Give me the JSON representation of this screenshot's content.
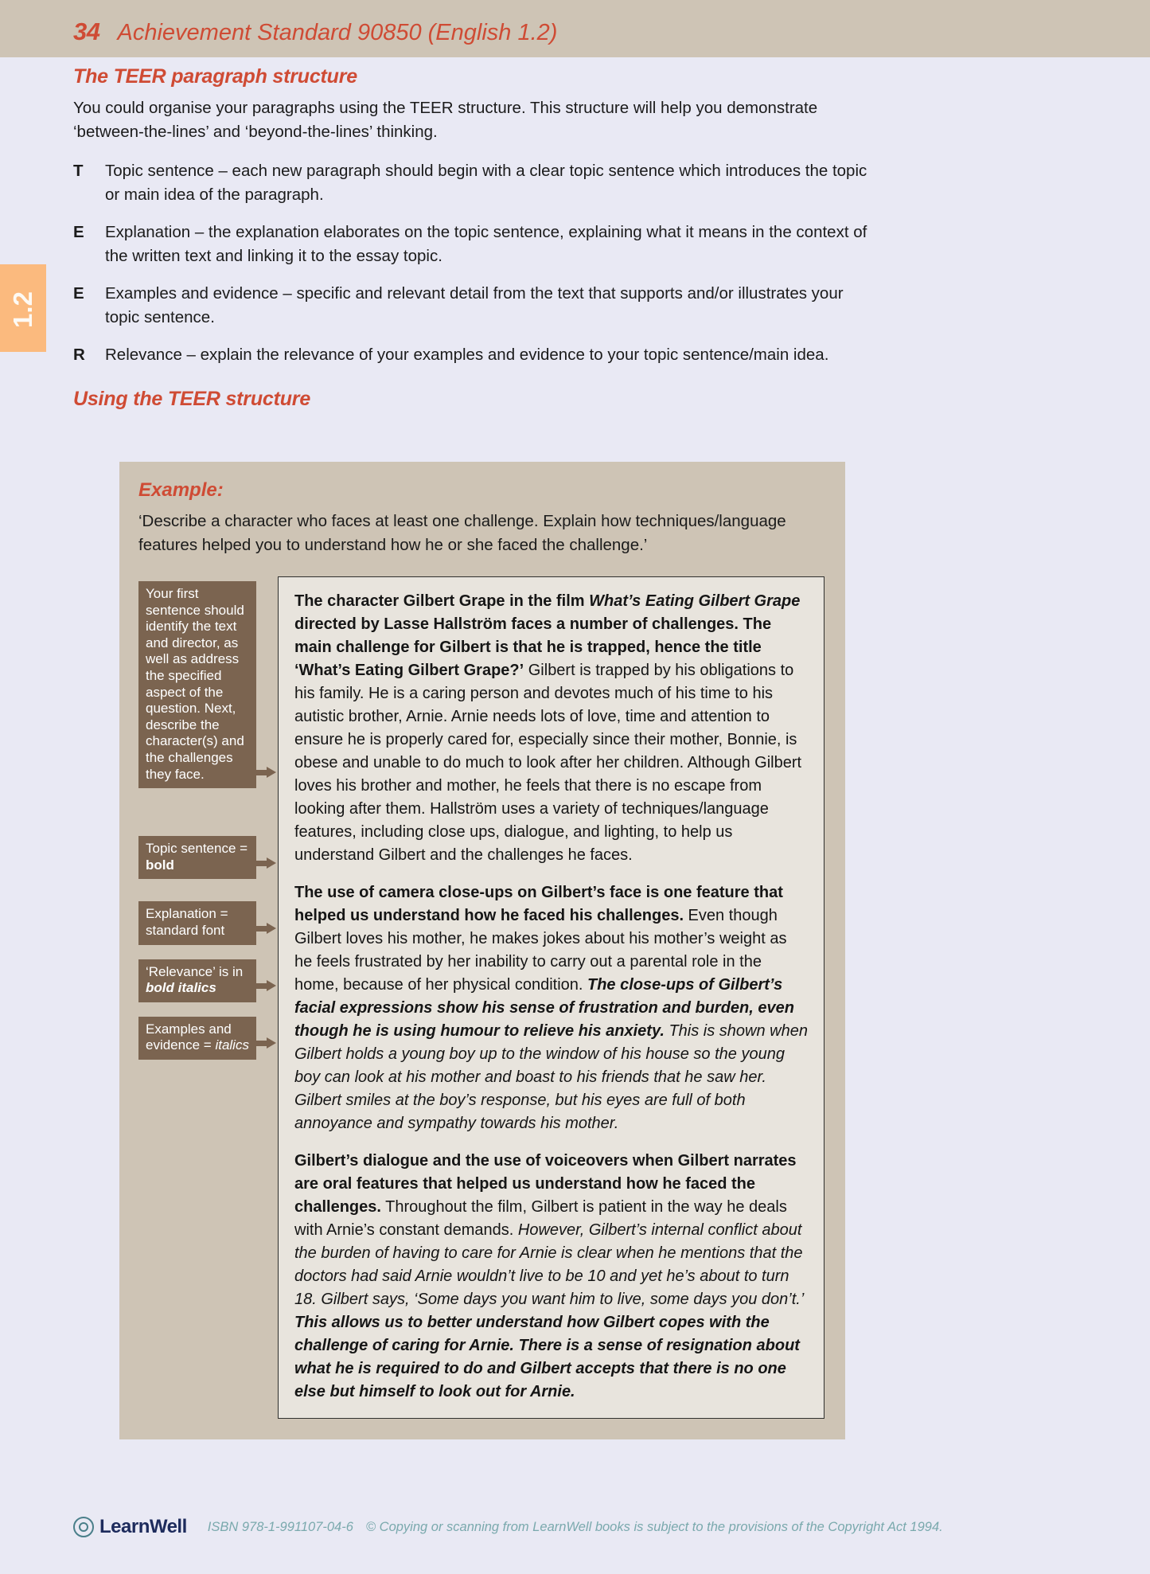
{
  "header": {
    "page_number": "34",
    "title": "Achievement Standard 90850 (English 1.2)"
  },
  "side_tab": {
    "label": "1.2"
  },
  "sections": {
    "heading_1": "The TEER paragraph structure",
    "intro": "You could organise your paragraphs using the TEER structure. This structure will help you demonstrate ‘between-the-lines’ and ‘beyond-the-lines’ thinking.",
    "heading_2": "Using the TEER structure"
  },
  "teer_items": [
    {
      "letter": "T",
      "text": "Topic sentence – each new paragraph should begin with a clear topic sentence which introduces the topic or main idea of the paragraph."
    },
    {
      "letter": "E",
      "text": "Explanation – the explanation elaborates on the topic sentence, explaining what it means in the context of the written text and linking it to the essay topic."
    },
    {
      "letter": "E",
      "text": "Examples and evidence – specific and relevant detail from the text that supports and/or illustrates your topic sentence."
    },
    {
      "letter": "R",
      "text": "Relevance – explain the relevance of your examples and evidence to your topic sentence/main idea."
    }
  ],
  "example_box": {
    "title": "Example:",
    "prompt": "‘Describe a character who faces at least one challenge. Explain how techniques/language features helped you to understand how he or she faced the challenge.’",
    "callouts": [
      {
        "id": "first-sentence",
        "text_plain": "Your first sentence should identify the text and director, as well as address the specified aspect of the question. Next, describe the character(s) and the challenges they face."
      },
      {
        "id": "topic-sentence",
        "line1": "Topic sentence =",
        "line2_bold": "bold"
      },
      {
        "id": "explanation",
        "line1": "Explanation =",
        "line2": "standard font"
      },
      {
        "id": "relevance",
        "line1": "‘Relevance’ is in",
        "line2_bold_italic": "bold italics"
      },
      {
        "id": "examples-evidence",
        "line1": "Examples and",
        "line2_prefix": "evidence = ",
        "line2_italic": "italics"
      }
    ],
    "essay_paragraphs": [
      {
        "id": "paragraph-1",
        "runs": [
          {
            "style": "bold",
            "text": "The character Gilbert Grape in the film "
          },
          {
            "style": "bold-italic",
            "text": "What’s Eating Gilbert Grape"
          },
          {
            "style": "bold",
            "text": " directed by Lasse Hallström faces a number of challenges. The main challenge for Gilbert is that he is trapped, hence the title ‘What’s Eating Gilbert Grape?’"
          },
          {
            "style": "normal",
            "text": " Gilbert is trapped by his obligations to his family. He is a caring person and devotes much of his time to his autistic brother, Arnie. Arnie needs lots of love, time and attention to ensure he is properly cared for, especially since their mother, Bonnie, is obese and unable to do much to look after her children. Although Gilbert loves his brother and mother, he feels that there is no escape from looking after them. Hallström uses a variety of techniques/language features, including close ups, dialogue, and lighting, to help us understand Gilbert and the challenges he faces."
          }
        ]
      },
      {
        "id": "paragraph-2",
        "runs": [
          {
            "style": "bold",
            "text": "The use of camera close-ups on Gilbert’s face is one feature that helped us understand how he faced his challenges."
          },
          {
            "style": "normal",
            "text": " Even though Gilbert loves his mother, he makes jokes about his mother’s weight as he feels frustrated by her inability to carry out a parental role in the home, because of her physical condition. "
          },
          {
            "style": "bold-italic",
            "text": "The close-ups of Gilbert’s facial expressions show his sense of frustration and burden, even though he is using humour to relieve his anxiety."
          },
          {
            "style": "italic",
            "text": " This is shown when Gilbert holds a young boy up to the window of his house so the young boy can look at his mother and boast to his friends that he saw her. Gilbert smiles at the boy’s response, but his eyes are full of both annoyance and sympathy towards his mother."
          }
        ]
      },
      {
        "id": "paragraph-3",
        "runs": [
          {
            "style": "bold",
            "text": "Gilbert’s dialogue and the use of voiceovers when Gilbert narrates are oral features that helped us understand how he faced the challenges."
          },
          {
            "style": "normal",
            "text": " Throughout the film, Gilbert is patient in the way he deals with Arnie’s constant demands. "
          },
          {
            "style": "italic",
            "text": "However, Gilbert’s internal conflict about the burden of having to care for Arnie is clear when he mentions that the doctors had said Arnie wouldn’t live to be 10 and yet he’s about to turn 18. Gilbert says, ‘Some days you want him to live, some days you don’t.’"
          },
          {
            "style": "bold-italic",
            "text": " This allows us to better understand how Gilbert copes with the challenge of caring for Arnie. There is a sense of resignation about what he is required to do and Gilbert accepts that there is no one else but himself to look out for Arnie."
          }
        ]
      }
    ]
  },
  "footer": {
    "logo_text": "LearnWell",
    "isbn": "ISBN 978-1-991107-04-6",
    "copyright": "© Copying or scanning from LearnWell books is subject to the provisions of the Copyright Act 1994."
  }
}
